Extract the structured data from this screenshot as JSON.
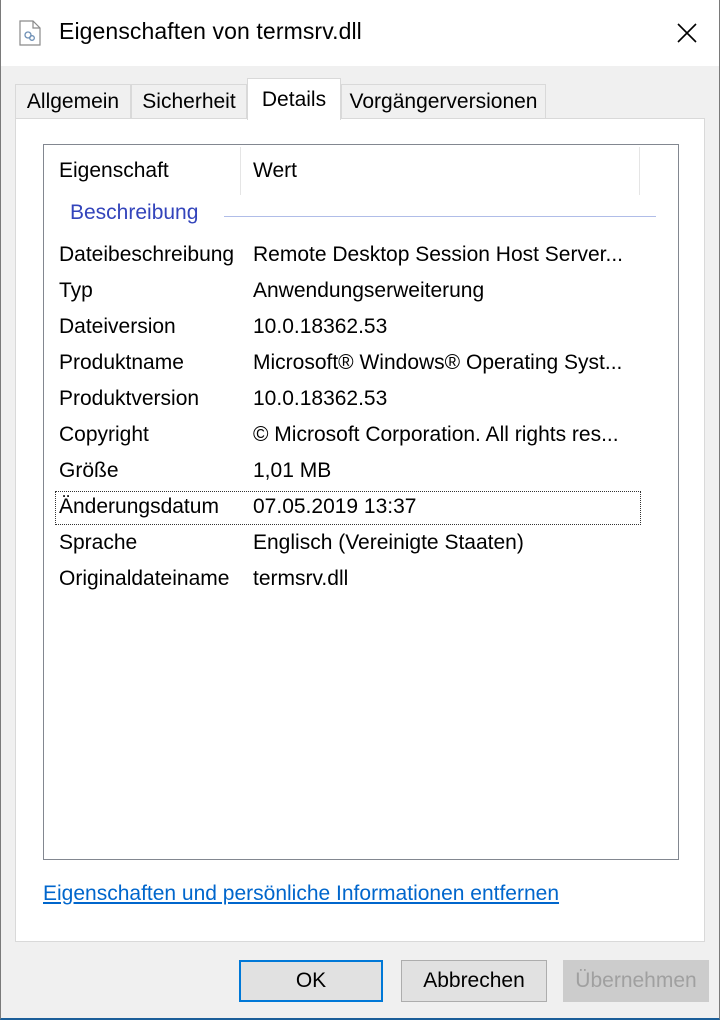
{
  "window": {
    "title": "Eigenschaften von termsrv.dll"
  },
  "tabs": [
    {
      "label": "Allgemein"
    },
    {
      "label": "Sicherheit"
    },
    {
      "label": "Details"
    },
    {
      "label": "Vorgängerversionen"
    }
  ],
  "active_tab": "Details",
  "list": {
    "columns": [
      "Eigenschaft",
      "Wert"
    ],
    "group": "Beschreibung",
    "rows": [
      {
        "name": "Dateibeschreibung",
        "value": "Remote Desktop Session Host Server..."
      },
      {
        "name": "Typ",
        "value": "Anwendungserweiterung"
      },
      {
        "name": "Dateiversion",
        "value": "10.0.18362.53"
      },
      {
        "name": "Produktname",
        "value": "Microsoft® Windows® Operating Syst..."
      },
      {
        "name": "Produktversion",
        "value": "10.0.18362.53"
      },
      {
        "name": "Copyright",
        "value": "© Microsoft Corporation. All rights res..."
      },
      {
        "name": "Größe",
        "value": "1,01 MB"
      },
      {
        "name": "Änderungsdatum",
        "value": "07.05.2019 13:37"
      },
      {
        "name": "Sprache",
        "value": "Englisch (Vereinigte Staaten)"
      },
      {
        "name": "Originaldateiname",
        "value": "termsrv.dll"
      }
    ],
    "focused_row": "Änderungsdatum"
  },
  "link": {
    "label": "Eigenschaften und persönliche Informationen entfernen"
  },
  "buttons": {
    "ok": "OK",
    "cancel": "Abbrechen",
    "apply": "Übernehmen"
  },
  "colors": {
    "accent": "#0078d7",
    "link": "#0066cc",
    "group_label": "#3344bb"
  }
}
